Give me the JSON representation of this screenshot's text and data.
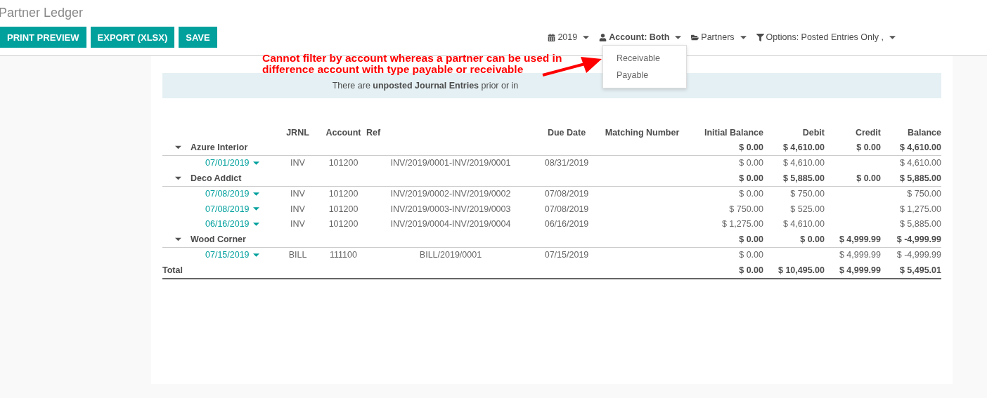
{
  "title": "Partner Ledger",
  "buttons": [
    "PRINT PREVIEW",
    "EXPORT (XLSX)",
    "SAVE"
  ],
  "filters": [
    {
      "kind": "calendar",
      "label": "2019",
      "open": false
    },
    {
      "kind": "user",
      "label": "Account: Both",
      "open": true
    },
    {
      "kind": "folder",
      "label": "Partners",
      "open": false
    },
    {
      "kind": "filter",
      "label": "Options: Posted Entries Only ,",
      "open": false
    }
  ],
  "account_menu": [
    "Receivable",
    "Payable"
  ],
  "annotation": {
    "lines": [
      "Cannot filter by account whereas a partner can be used in",
      "difference account with type payable or receivable"
    ]
  },
  "notice": "There are **unposted Journal Entries** prior or in",
  "table": {
    "columns": [
      "",
      "JRNL",
      "Account",
      "Ref",
      "Due Date",
      "Matching Number",
      "Initial Balance",
      "Debit",
      "Credit",
      "Balance"
    ],
    "partners": [
      {
        "name": "Azure Interior",
        "expanded": true,
        "initial_balance": "$ 0.00",
        "debit": "$ 4,610.00",
        "credit": "$ 0.00",
        "balance": "$ 4,610.00",
        "lines": [
          {
            "date": "07/01/2019",
            "jrnl": "INV",
            "account": "101200",
            "ref": "INV/2019/0001-INV/2019/0001",
            "due_date": "08/31/2019",
            "initial_balance": "$ 0.00",
            "debit": "$ 4,610.00",
            "balance": "$ 4,610.00"
          }
        ]
      },
      {
        "name": "Deco Addict",
        "expanded": true,
        "initial_balance": "$ 0.00",
        "debit": "$ 5,885.00",
        "credit": "$ 0.00",
        "balance": "$ 5,885.00",
        "lines": [
          {
            "date": "07/08/2019",
            "jrnl": "INV",
            "account": "101200",
            "ref": "INV/2019/0002-INV/2019/0002",
            "due_date": "07/08/2019",
            "initial_balance": "$ 0.00",
            "debit": "$ 750.00",
            "balance": "$ 750.00"
          },
          {
            "date": "07/08/2019",
            "jrnl": "INV",
            "account": "101200",
            "ref": "INV/2019/0003-INV/2019/0003",
            "due_date": "07/08/2019",
            "initial_balance": "$ 750.00",
            "debit": "$ 525.00",
            "balance": "$ 1,275.00"
          },
          {
            "date": "06/16/2019",
            "jrnl": "INV",
            "account": "101200",
            "ref": "INV/2019/0004-INV/2019/0004",
            "due_date": "06/16/2019",
            "initial_balance": "$ 1,275.00",
            "debit": "$ 4,610.00",
            "balance": "$ 5,885.00"
          }
        ]
      },
      {
        "name": "Wood Corner",
        "expanded": true,
        "initial_balance": "$ 0.00",
        "debit": "$ 0.00",
        "credit": "$ 4,999.99",
        "balance": "$ -4,999.99",
        "lines": [
          {
            "date": "07/15/2019",
            "jrnl": "BILL",
            "account": "111100",
            "ref": "BILL/2019/0001",
            "due_date": "07/15/2019",
            "initial_balance": "$ 0.00",
            "credit": "$ 4,999.99",
            "balance": "$ -4,999.99"
          }
        ]
      }
    ],
    "total": {
      "label": "Total",
      "initial_balance": "$ 0.00",
      "debit": "$ 10,495.00",
      "credit": "$ 4,999.99",
      "balance": "$ 5,495.01"
    }
  }
}
